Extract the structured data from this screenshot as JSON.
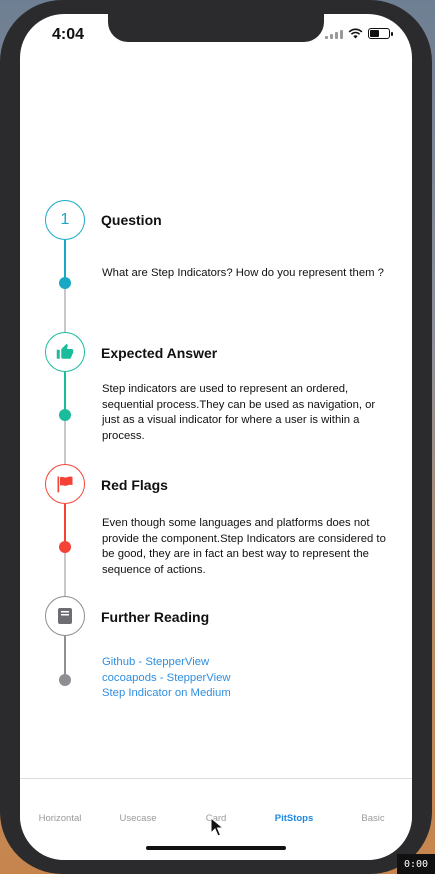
{
  "status_bar": {
    "time": "4:04"
  },
  "colors": {
    "teal": "#1aa9c4",
    "green": "#1abc9c",
    "red": "#f44336",
    "gray": "#8e8e93",
    "link": "#2f8fe0",
    "tab_active": "#1e88e5"
  },
  "steps": [
    {
      "indicator_text": "1",
      "title": "Question",
      "description": "What are Step Indicators? How do you represent them ?",
      "color": "#1aa9c4"
    },
    {
      "icon": "thumbs-up-icon",
      "title": "Expected Answer",
      "description": "Step indicators are used to represent an ordered, sequential process.They can be used as navigation, or just as a visual indicator for where a user is within a process.",
      "color": "#1abc9c"
    },
    {
      "icon": "flag-icon",
      "title": "Red Flags",
      "description": "Even though some languages and platforms does not provide the component.Step Indicators are considered to be good, they are in fact an best way to represent the sequence of actions.",
      "color": "#f44336"
    },
    {
      "icon": "book-icon",
      "title": "Further Reading",
      "links": [
        "Github - StepperView",
        "cocoapods - StepperView",
        "Step Indicator on  Medium"
      ],
      "color": "#8e8e93"
    }
  ],
  "tabs": [
    {
      "label": "Horizontal",
      "active": false
    },
    {
      "label": "Usecase",
      "active": false
    },
    {
      "label": "Card",
      "active": false
    },
    {
      "label": "PitStops",
      "active": true
    },
    {
      "label": "Basic",
      "active": false
    }
  ],
  "corner_badge": "0:00"
}
